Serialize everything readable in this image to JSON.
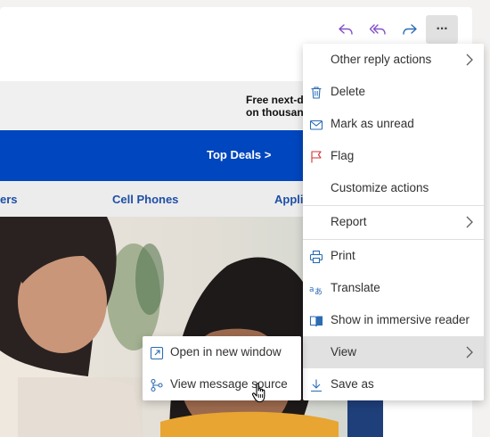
{
  "email": {
    "shipping_line1": "Free next-d",
    "shipping_line2": "on thousan",
    "deals_label": "Top Deals >",
    "nav": [
      "ers",
      "Cell Phones",
      "Appli"
    ]
  },
  "toolbar": {
    "icons": [
      "reply-icon",
      "reply-all-icon",
      "forward-icon",
      "more-actions-icon"
    ],
    "more_glyph": "···"
  },
  "menu": {
    "items": [
      {
        "label": "Other reply actions",
        "icon": "none",
        "submenu": true
      },
      {
        "label": "Delete",
        "icon": "trash-icon"
      },
      {
        "label": "Mark as unread",
        "icon": "envelope-icon"
      },
      {
        "label": "Flag",
        "icon": "flag-icon"
      },
      {
        "label": "Customize actions",
        "icon": "none"
      },
      {
        "label": "Report",
        "icon": "none",
        "submenu": true
      },
      {
        "label": "Print",
        "icon": "printer-icon"
      },
      {
        "label": "Translate",
        "icon": "translate-icon"
      },
      {
        "label": "Show in immersive reader",
        "icon": "immersive-reader-icon"
      },
      {
        "label": "View",
        "icon": "none",
        "submenu": true,
        "highlighted": true
      },
      {
        "label": "Save as",
        "icon": "download-icon"
      }
    ]
  },
  "view_submenu": {
    "items": [
      {
        "label": "Open in new window",
        "icon": "new-window-icon"
      },
      {
        "label": "View message source",
        "icon": "message-source-icon"
      }
    ]
  },
  "colors": {
    "accent": "#6b47c0",
    "brand_blue": "#0046be",
    "menu_icon_blue": "#2b6cb3",
    "flag_red": "#d13438"
  }
}
